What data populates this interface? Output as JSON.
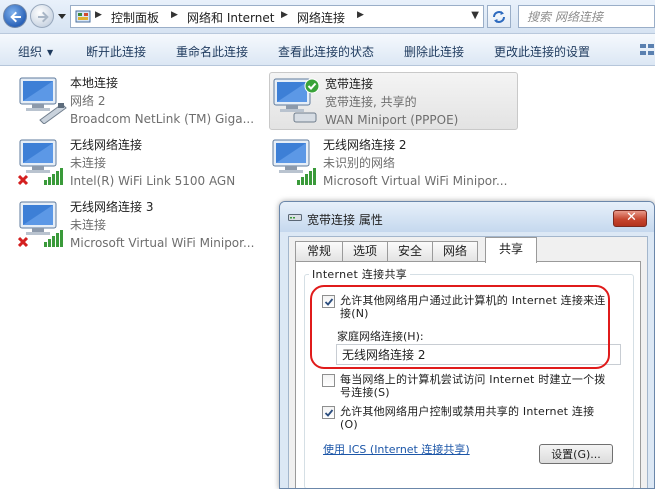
{
  "address": {
    "breadcrumbs": [
      "控制面板",
      "网络和 Internet",
      "网络连接"
    ],
    "search_placeholder": "搜索 网络连接"
  },
  "toolbar": {
    "organize": "组织",
    "disconnect": "断开此连接",
    "rename": "重命名此连接",
    "view_status": "查看此连接的状态",
    "delete": "删除此连接",
    "change_settings": "更改此连接的设置"
  },
  "connections": [
    {
      "name": "本地连接",
      "status": "网络  2",
      "device": "Broadcom NetLink (TM) Giga...",
      "icon": "wired-lan-icon"
    },
    {
      "name": "宽带连接",
      "status": "宽带连接, 共享的",
      "device": "WAN Miniport (PPPOE)",
      "icon": "broadband-connected-icon",
      "selected": true
    },
    {
      "name": "无线网络连接",
      "status": "未连接",
      "device": "Intel(R) WiFi Link 5100 AGN",
      "icon": "wireless-disconnected-icon"
    },
    {
      "name": "无线网络连接 2",
      "status": "未识别的网络",
      "device": "Microsoft Virtual WiFi Minipor...",
      "icon": "wireless-connected-icon"
    },
    {
      "name": "无线网络连接 3",
      "status": "未连接",
      "device": "Microsoft Virtual WiFi Minipor...",
      "icon": "wireless-disconnected-icon"
    }
  ],
  "dialog": {
    "title": "宽带连接 属性",
    "tabs": [
      "常规",
      "选项",
      "安全",
      "网络",
      "共享"
    ],
    "active_tab": "共享",
    "group_title": "Internet 连接共享",
    "allow_share": {
      "label": "允许其他网络用户通过此计算机的 Internet 连接来连接(N)",
      "checked": true
    },
    "home_network_label": "家庭网络连接(H):",
    "home_network_value": "无线网络连接 2",
    "dial_on_demand": {
      "label": "每当网络上的计算机尝试访问 Internet 时建立一个拨号连接(S)",
      "checked": false
    },
    "allow_control": {
      "label": "允许其他网络用户控制或禁用共享的 Internet 连接(O)",
      "checked": true
    },
    "ics_link": "使用 ICS (Internet 连接共享)",
    "settings_button": "设置(G)..."
  },
  "colors": {
    "highlight_ring": "#e01b1b",
    "link": "#1c56a8",
    "close_button": "#c6462f"
  }
}
